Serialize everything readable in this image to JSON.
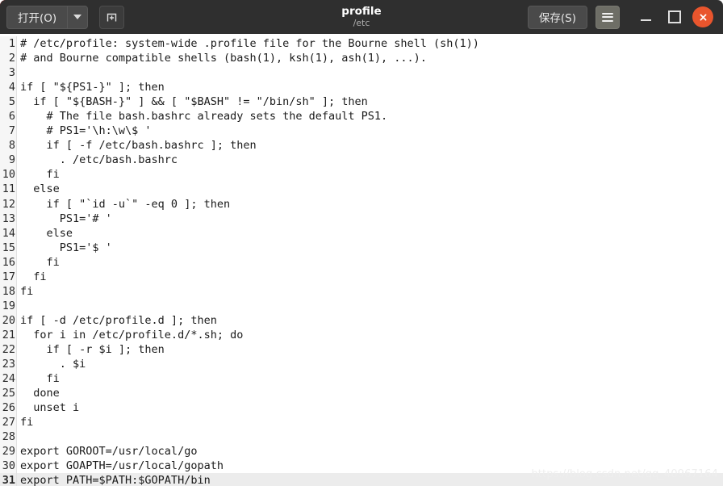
{
  "titlebar": {
    "open_button_label": "打开(O)",
    "open_dropdown_name": "open-dropdown-arrow",
    "new_document_icon": "new-document-icon",
    "document_title": "profile",
    "document_path": "/etc",
    "save_button_label": "保存(S)",
    "menu_icon": "hamburger-menu-icon",
    "minimize_icon": "minimize-icon",
    "maximize_icon": "maximize-icon",
    "close_icon": "close-icon",
    "colors": {
      "titlebar_bg": "#2f2f2f",
      "button_bg": "#4a4a4a",
      "menu_button_bg": "#6e6e66",
      "close_button_bg": "#e9552d",
      "title_text": "#ffffff",
      "subtitle_text": "#b0b0b0"
    }
  },
  "editor": {
    "current_line": 31,
    "colors": {
      "background": "#ffffff",
      "gutter_bg": "#f6f6f6",
      "current_line_bg": "#ececec",
      "text": "#1a1a1a"
    },
    "lines": [
      {
        "n": "1",
        "text": "# /etc/profile: system-wide .profile file for the Bourne shell (sh(1))"
      },
      {
        "n": "2",
        "text": "# and Bourne compatible shells (bash(1), ksh(1), ash(1), ...)."
      },
      {
        "n": "3",
        "text": ""
      },
      {
        "n": "4",
        "text": "if [ \"${PS1-}\" ]; then"
      },
      {
        "n": "5",
        "text": "  if [ \"${BASH-}\" ] && [ \"$BASH\" != \"/bin/sh\" ]; then"
      },
      {
        "n": "6",
        "text": "    # The file bash.bashrc already sets the default PS1."
      },
      {
        "n": "7",
        "text": "    # PS1='\\h:\\w\\$ '"
      },
      {
        "n": "8",
        "text": "    if [ -f /etc/bash.bashrc ]; then"
      },
      {
        "n": "9",
        "text": "      . /etc/bash.bashrc"
      },
      {
        "n": "10",
        "text": "    fi"
      },
      {
        "n": "11",
        "text": "  else"
      },
      {
        "n": "12",
        "text": "    if [ \"`id -u`\" -eq 0 ]; then"
      },
      {
        "n": "13",
        "text": "      PS1='# '"
      },
      {
        "n": "14",
        "text": "    else"
      },
      {
        "n": "15",
        "text": "      PS1='$ '"
      },
      {
        "n": "16",
        "text": "    fi"
      },
      {
        "n": "17",
        "text": "  fi"
      },
      {
        "n": "18",
        "text": "fi"
      },
      {
        "n": "19",
        "text": ""
      },
      {
        "n": "20",
        "text": "if [ -d /etc/profile.d ]; then"
      },
      {
        "n": "21",
        "text": "  for i in /etc/profile.d/*.sh; do"
      },
      {
        "n": "22",
        "text": "    if [ -r $i ]; then"
      },
      {
        "n": "23",
        "text": "      . $i"
      },
      {
        "n": "24",
        "text": "    fi"
      },
      {
        "n": "25",
        "text": "  done"
      },
      {
        "n": "26",
        "text": "  unset i"
      },
      {
        "n": "27",
        "text": "fi"
      },
      {
        "n": "28",
        "text": ""
      },
      {
        "n": "29",
        "text": "export GOROOT=/usr/local/go"
      },
      {
        "n": "30",
        "text": "export GOAPTH=/usr/local/gopath"
      },
      {
        "n": "31",
        "text": "export PATH=$PATH:$GOPATH/bin"
      }
    ]
  },
  "watermark": {
    "text": "https://blog.csdn.net/qq_40967164"
  }
}
